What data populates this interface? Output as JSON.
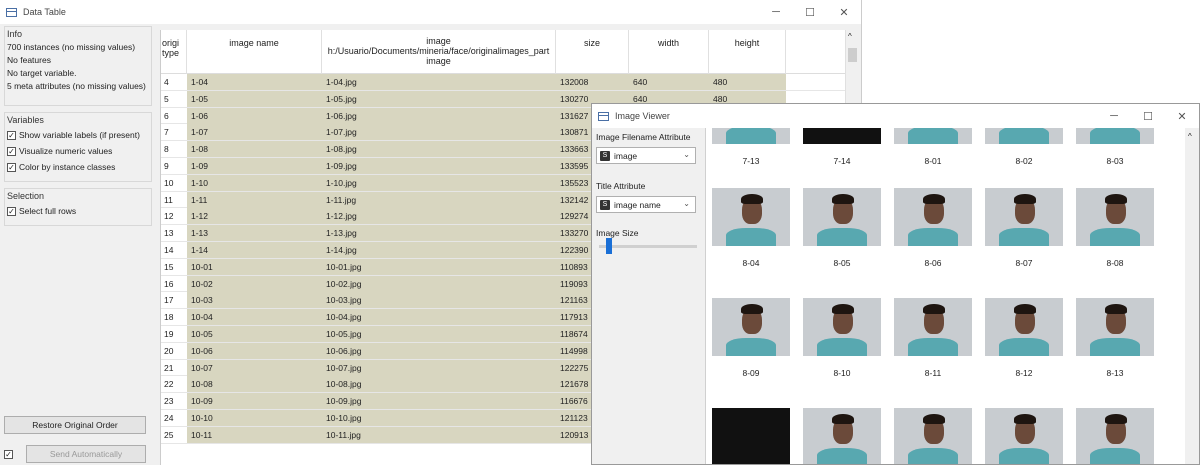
{
  "dt": {
    "title": "Data Table",
    "info_head": "Info",
    "info": [
      "700 instances (no missing values)",
      "No features",
      "No target variable.",
      "5 meta attributes (no missing values)"
    ],
    "var_head": "Variables",
    "var_opts": [
      "Show variable labels (if present)",
      "Visualize numeric values",
      "Color by instance classes"
    ],
    "sel_head": "Selection",
    "sel_opt": "Select full rows",
    "restore": "Restore Original Order",
    "send": "Send Automatically",
    "headers": {
      "orig1": "origi",
      "orig2": "type",
      "name": "image name",
      "img1": "image",
      "img2": "h:/Usuario/Documents/mineria/face/originalimages_part",
      "img3": "image",
      "size": "size",
      "width": "width",
      "height": "height"
    },
    "rows": [
      [
        "4",
        "1-04",
        "1-04.jpg",
        "132008",
        "640",
        "480"
      ],
      [
        "5",
        "1-05",
        "1-05.jpg",
        "130270",
        "640",
        "480"
      ],
      [
        "6",
        "1-06",
        "1-06.jpg",
        "131627",
        "",
        ""
      ],
      [
        "7",
        "1-07",
        "1-07.jpg",
        "130871",
        "",
        ""
      ],
      [
        "8",
        "1-08",
        "1-08.jpg",
        "133663",
        "",
        ""
      ],
      [
        "9",
        "1-09",
        "1-09.jpg",
        "133595",
        "",
        ""
      ],
      [
        "10",
        "1-10",
        "1-10.jpg",
        "135523",
        "",
        ""
      ],
      [
        "11",
        "1-11",
        "1-11.jpg",
        "132142",
        "",
        ""
      ],
      [
        "12",
        "1-12",
        "1-12.jpg",
        "129274",
        "",
        ""
      ],
      [
        "13",
        "1-13",
        "1-13.jpg",
        "133270",
        "",
        ""
      ],
      [
        "14",
        "1-14",
        "1-14.jpg",
        "122390",
        "",
        ""
      ],
      [
        "15",
        "10-01",
        "10-01.jpg",
        "110893",
        "",
        ""
      ],
      [
        "16",
        "10-02",
        "10-02.jpg",
        "119093",
        "",
        ""
      ],
      [
        "17",
        "10-03",
        "10-03.jpg",
        "121163",
        "",
        ""
      ],
      [
        "18",
        "10-04",
        "10-04.jpg",
        "117913",
        "",
        ""
      ],
      [
        "19",
        "10-05",
        "10-05.jpg",
        "118674",
        "",
        ""
      ],
      [
        "20",
        "10-06",
        "10-06.jpg",
        "114998",
        "",
        ""
      ],
      [
        "21",
        "10-07",
        "10-07.jpg",
        "122275",
        "",
        ""
      ],
      [
        "22",
        "10-08",
        "10-08.jpg",
        "121678",
        "",
        ""
      ],
      [
        "23",
        "10-09",
        "10-09.jpg",
        "116676",
        "",
        ""
      ],
      [
        "24",
        "10-10",
        "10-10.jpg",
        "121123",
        "",
        ""
      ],
      [
        "25",
        "10-11",
        "10-11.jpg",
        "120913",
        "",
        ""
      ]
    ]
  },
  "iv": {
    "title": "Image Viewer",
    "fn_label": "Image Filename Attribute",
    "fn_value": "image",
    "title_label": "Title Attribute",
    "title_value": "image name",
    "size_label": "Image Size",
    "thumbs": [
      "7-13",
      "7-14",
      "8-01",
      "8-02",
      "8-03",
      "8-04",
      "8-05",
      "8-06",
      "8-07",
      "8-08",
      "8-09",
      "8-10",
      "8-11",
      "8-12",
      "8-13"
    ]
  },
  "colors": {
    "meta_bg": "#d8d6c0",
    "accent": "#1a6fd6"
  }
}
